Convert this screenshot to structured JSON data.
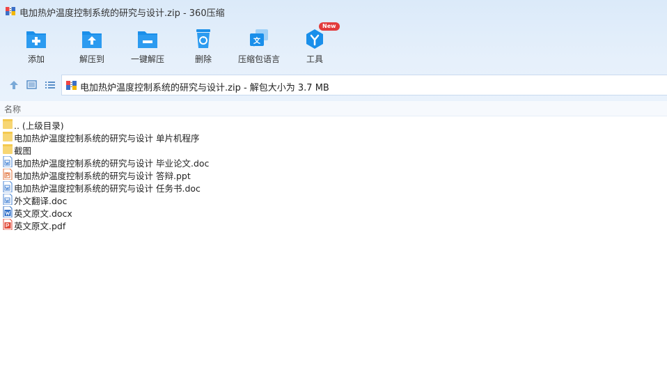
{
  "window": {
    "title": "电加热炉温度控制系统的研究与设计.zip - 360压缩"
  },
  "toolbar": [
    {
      "label": "添加",
      "icon": "add-folder-icon"
    },
    {
      "label": "解压到",
      "icon": "extract-to-icon"
    },
    {
      "label": "一键解压",
      "icon": "one-click-extract-icon"
    },
    {
      "label": "删除",
      "icon": "recycle-bin-icon"
    },
    {
      "label": "压缩包语言",
      "icon": "archive-language-icon"
    },
    {
      "label": "工具",
      "icon": "tools-icon",
      "badge": "New"
    }
  ],
  "address": {
    "path": "电加热炉温度控制系统的研究与设计.zip - 解包大小为 3.7 MB"
  },
  "list": {
    "header": "名称",
    "files": [
      {
        "name": ".. (上级目录)",
        "type": "folder"
      },
      {
        "name": "电加热炉温度控制系统的研究与设计 单片机程序",
        "type": "folder"
      },
      {
        "name": "截图",
        "type": "folder"
      },
      {
        "name": "电加热炉温度控制系统的研究与设计 毕业论文.doc",
        "type": "doc"
      },
      {
        "name": "电加热炉温度控制系统的研究与设计 答辩.ppt",
        "type": "ppt"
      },
      {
        "name": "电加热炉温度控制系统的研究与设计 任务书.doc",
        "type": "doc"
      },
      {
        "name": "外文翻译.doc",
        "type": "doc"
      },
      {
        "name": "英文原文.docx",
        "type": "docx"
      },
      {
        "name": "英文原文.pdf",
        "type": "pdf"
      }
    ]
  },
  "colors": {
    "accent": "#1a8fea",
    "folder": "#f7d674",
    "badge": "#e23b3b",
    "pdf": "#e04a3a",
    "ppt": "#e0703a",
    "doc": "#3f7fd3"
  }
}
